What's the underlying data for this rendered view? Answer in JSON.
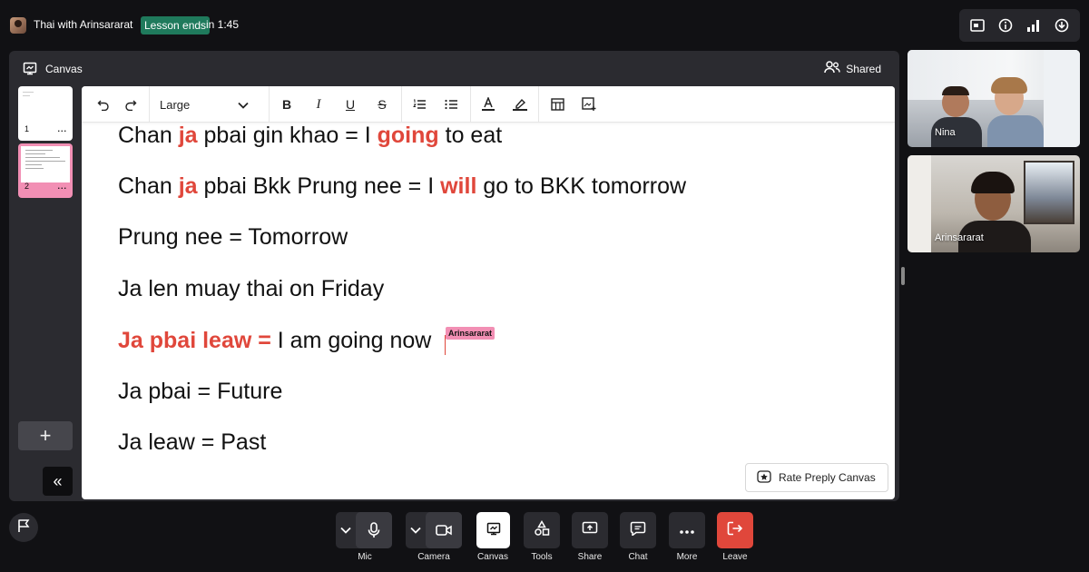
{
  "topbar": {
    "lesson_title": "Thai with Arinsararat",
    "badge": "Lesson ends",
    "time": "in 1:45",
    "tools": [
      "picture-in-picture-icon",
      "info-icon",
      "signal-icon",
      "download-icon"
    ]
  },
  "panel": {
    "title": "Canvas",
    "shared_label": "Shared",
    "slides": [
      {
        "num": "1",
        "more": "..."
      },
      {
        "num": "2",
        "more": "..."
      }
    ],
    "add_label": "+",
    "collapse_label": "«"
  },
  "toolbar": {
    "font_size": "Large",
    "buttons": [
      "undo-icon",
      "redo-icon",
      "bold-icon",
      "italic-icon",
      "underline-icon",
      "strikethrough-icon",
      "numbered-list-icon",
      "bullet-list-icon",
      "text-color-icon",
      "highlight-icon",
      "table-icon",
      "insert-image-icon"
    ]
  },
  "doc": {
    "l1": {
      "a": "Chan ",
      "b": "ja",
      "c": " pbai gin khao = I ",
      "d": "going",
      "e": " to eat"
    },
    "l2": {
      "a": "Chan ",
      "b": "ja",
      "c": " pbai Bkk Prung nee = I ",
      "d": "will",
      "e": " go to BKK tomorrow"
    },
    "l3": "Prung nee = Tomorrow",
    "l4": "Ja len muay thai on Friday",
    "l5": {
      "a": "Ja pbai leaw =",
      "b": " I am going now"
    },
    "l6": "Ja pbai = Future",
    "l7": "Ja leaw = Past",
    "cursor_user": "Arinsararat"
  },
  "rate_label": "Rate Preply Canvas",
  "videos": [
    {
      "name": "Nina"
    },
    {
      "name": "Arinsararat"
    }
  ],
  "controls": {
    "mic": "Mic",
    "camera": "Camera",
    "canvas": "Canvas",
    "tools": "Tools",
    "share": "Share",
    "chat": "Chat",
    "more": "More",
    "leave": "Leave"
  },
  "colors": {
    "accent_red": "#e0473b",
    "badge_green": "#1f7a5c",
    "pink": "#f28fb4",
    "leave_red": "#e0473b"
  }
}
